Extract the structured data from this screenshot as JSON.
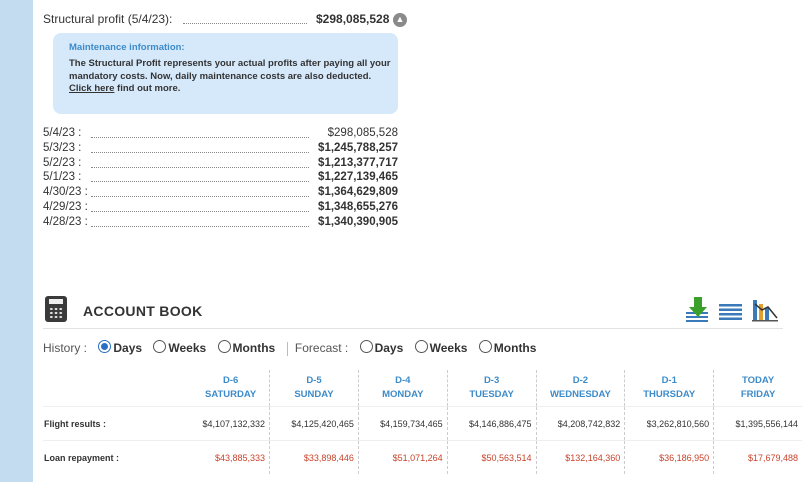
{
  "structural_profit": {
    "label": "Structural profit (5/4/23):",
    "value": "$298,085,528",
    "toggle_icon": "chevron-up-icon"
  },
  "maintenance": {
    "title": "Maintenance information:",
    "text": "The Structural Profit represents your actual profits after paying all your mandatory costs. Now, daily maintenance costs are also deducted.",
    "link": "Click here",
    "link_suffix": " find out more."
  },
  "history": [
    {
      "date": "5/4/23 :",
      "value": "$298,085,528"
    },
    {
      "date": "5/3/23 :",
      "value": "$1,245,788,257"
    },
    {
      "date": "5/2/23 :",
      "value": "$1,213,377,717"
    },
    {
      "date": "5/1/23 :",
      "value": "$1,227,139,465"
    },
    {
      "date": "4/30/23 :",
      "value": "$1,364,629,809"
    },
    {
      "date": "4/29/23 :",
      "value": "$1,348,655,276"
    },
    {
      "date": "4/28/23 :",
      "value": "$1,340,390,905"
    }
  ],
  "account_book": {
    "title": "ACCOUNT BOOK",
    "icons": [
      "calculator-icon",
      "download-icon",
      "list-icon",
      "chart-icon"
    ]
  },
  "period": {
    "history_label": "History :",
    "forecast_label": "Forecast :",
    "history_options": [
      "Days",
      "Weeks",
      "Months"
    ],
    "forecast_options": [
      "Days",
      "Weeks",
      "Months"
    ],
    "history_selected": "Days"
  },
  "table": {
    "columns": [
      {
        "d": "D-6",
        "day": "SATURDAY"
      },
      {
        "d": "D-5",
        "day": "SUNDAY"
      },
      {
        "d": "D-4",
        "day": "MONDAY"
      },
      {
        "d": "D-3",
        "day": "TUESDAY"
      },
      {
        "d": "D-2",
        "day": "WEDNESDAY"
      },
      {
        "d": "D-1",
        "day": "THURSDAY"
      },
      {
        "d": "TODAY",
        "day": "FRIDAY"
      }
    ],
    "rows": [
      {
        "label": "Flight results :",
        "values": [
          "$4,107,132,332",
          "$4,125,420,465",
          "$4,159,734,465",
          "$4,146,886,475",
          "$4,208,742,832",
          "$3,262,810,560",
          "$1,395,556,144"
        ]
      },
      {
        "label": "Loan repayment :",
        "values": [
          "$43,885,333",
          "$33,898,446",
          "$51,071,264",
          "$50,563,514",
          "$132,164,360",
          "$36,186,950",
          "$17,679,488"
        ]
      }
    ]
  },
  "colors": {
    "accent": "#3d8bc9",
    "negative": "#c8432c",
    "background": "#c4dcef"
  }
}
